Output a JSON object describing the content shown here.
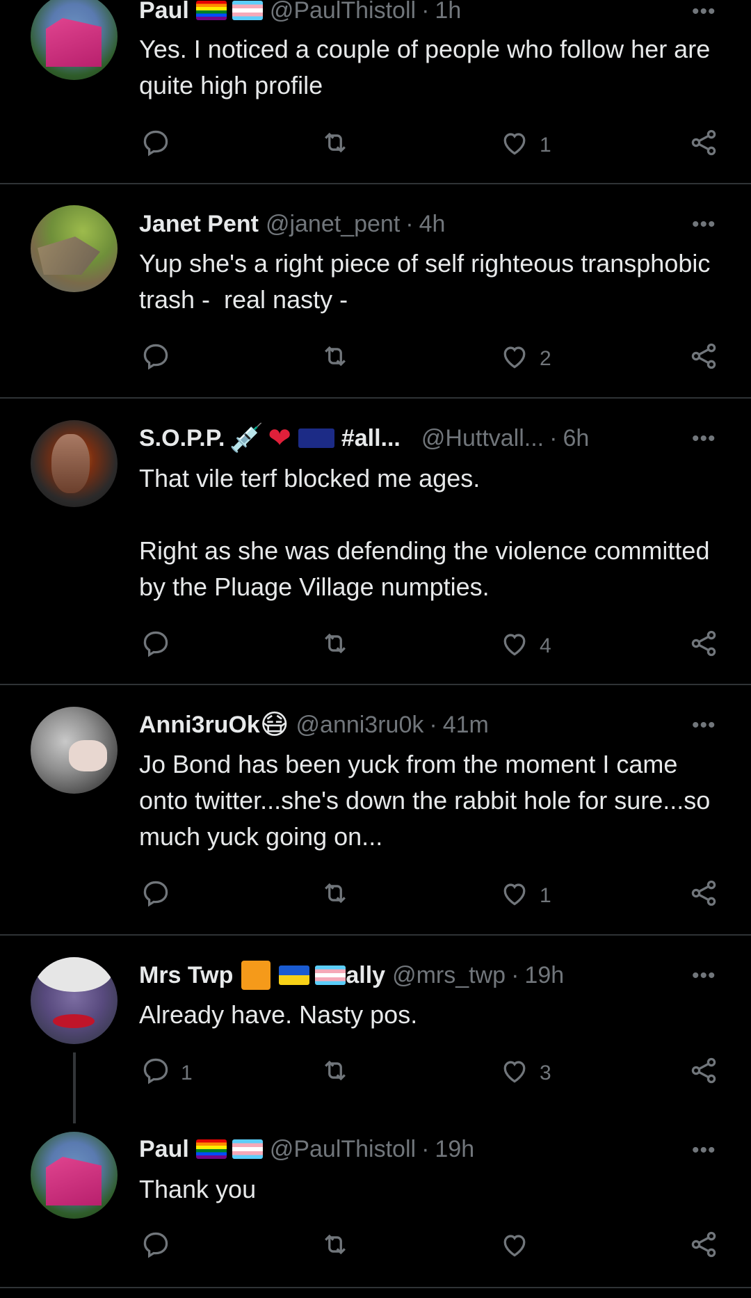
{
  "tweets": [
    {
      "name": "Paul",
      "handle": "@PaulThistoll",
      "time": "1h",
      "text": "Yes. I noticed a couple of people who follow her are quite high profile",
      "replies": "",
      "likes": "1"
    },
    {
      "name": "Janet Pent",
      "handle": "@janet_pent",
      "time": "4h",
      "text": "Yup she's a right piece of self righteous transphobic trash -  real nasty -",
      "replies": "",
      "likes": "2"
    },
    {
      "name": "S.O.P.P.",
      "name_suffix": "#all...",
      "handle": "@Huttvall...",
      "time": "6h",
      "text": "That vile terf blocked me ages.\n\nRight as she was defending the violence committed by the Pluage Village numpties.",
      "replies": "",
      "likes": "4"
    },
    {
      "name": "Anni3ruOk",
      "handle": "@anni3ru0k",
      "time": "41m",
      "text": "Jo Bond has been yuck from the moment I came onto twitter...she's down the rabbit hole for sure...so much yuck going on...",
      "replies": "",
      "likes": "1"
    },
    {
      "name": "Mrs Twp",
      "name_suffix": "ally",
      "handle": "@mrs_twp",
      "time": "19h",
      "text": "Already have. Nasty pos.",
      "replies": "1",
      "likes": "3"
    },
    {
      "name": "Paul",
      "handle": "@PaulThistoll",
      "time": "19h",
      "text": "Thank you",
      "replies": "",
      "likes": ""
    }
  ],
  "separator": "·",
  "more_glyph": "•••",
  "icons": [
    "reply-icon",
    "retweet-icon",
    "like-icon",
    "share-icon",
    "more-icon"
  ],
  "colors": {
    "background": "#000000",
    "text": "#e7e9ea",
    "muted": "#71767b",
    "divider": "#2f3336"
  }
}
